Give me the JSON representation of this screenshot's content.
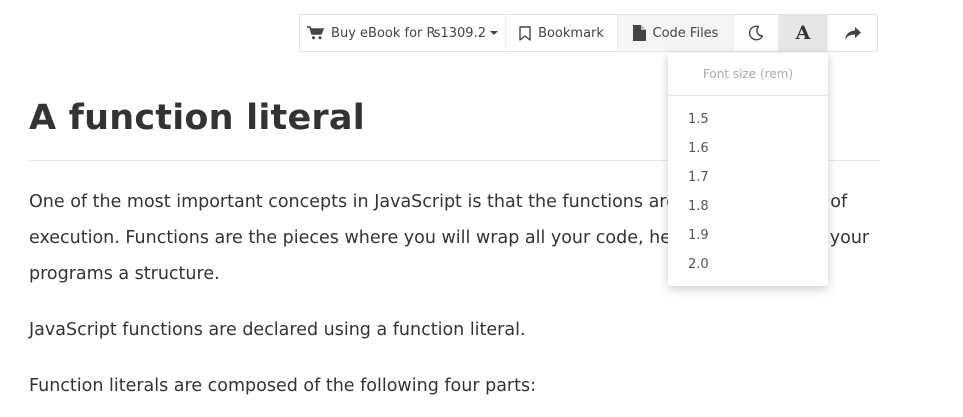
{
  "toolbar": {
    "buy_label": "Buy eBook for ₨1309.2",
    "bookmark_label": "Bookmark",
    "code_files_label": "Code Files",
    "font_button_label": "A"
  },
  "font_menu": {
    "header": "Font size (rem)",
    "options": [
      "1.5",
      "1.6",
      "1.7",
      "1.8",
      "1.9",
      "2.0"
    ]
  },
  "article": {
    "title": "A function literal",
    "paragraphs": [
      "One of the most important concepts in JavaScript is that the functions are the primary unit of execution. Functions are the pieces where you will wrap all your code, hence they will give your programs a structure.",
      "JavaScript functions are declared using a function literal.",
      "Function literals are composed of the following four parts:"
    ]
  }
}
